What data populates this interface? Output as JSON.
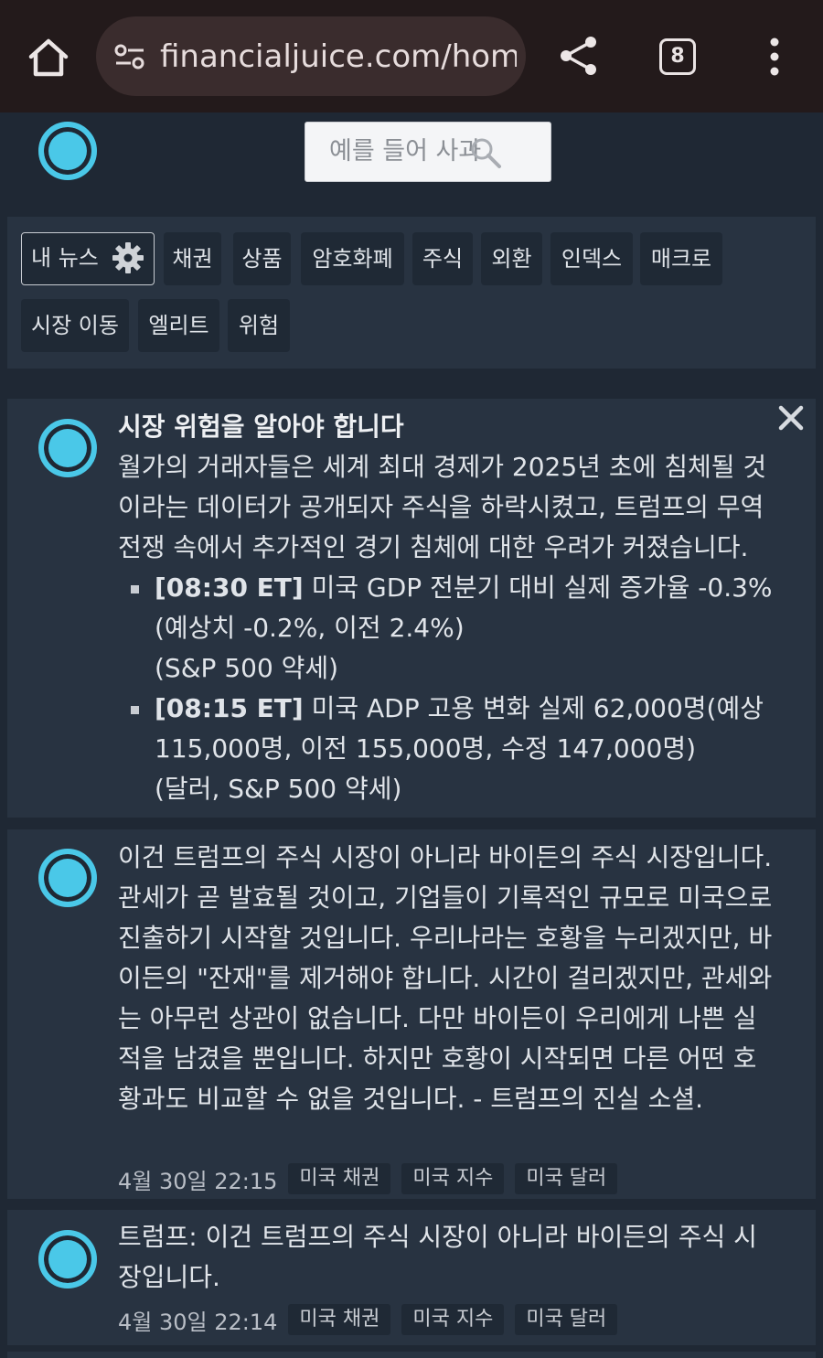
{
  "browser": {
    "url": "financialjuice.com/home",
    "tab_count": "8"
  },
  "search": {
    "placeholder": "예를 들어 사과"
  },
  "categories": {
    "mine_label": "내 뉴스",
    "items": [
      "채권",
      "상품",
      "암호화폐",
      "주식",
      "외환",
      "인덱스",
      "매크로",
      "시장 이동",
      "엘리트",
      "위험"
    ]
  },
  "cards": [
    {
      "headline": "시장 위험을 알아야 합니다",
      "body": "월가의 거래자들은 세계 최대 경제가 2025년 초에 침체될 것이라는 데이터가 공개되자 주식을 하락시켰고, 트럼프의 무역 전쟁 속에서 추가적인 경기 침체에 대한 우려가 커졌습니다.",
      "bullets": [
        {
          "time": "[08:30 ET]",
          "text": " 미국 GDP 전분기 대비 실제 증가율 -0.3% (예상치 -0.2%, 이전 2.4%)",
          "note": "(S&P 500 약세)"
        },
        {
          "time": "[08:15 ET]",
          "text": "  미국 ADP 고용 변화 실제 62,000명(예상 115,000명, 이전 155,000명, 수정 147,000명)",
          "note": "(달러, S&P 500 약세)"
        }
      ]
    },
    {
      "body": "이건 트럼프의 주식 시장이 아니라 바이든의 주식 시장입니다. 관세가 곧 발효될 것이고, 기업들이 기록적인 규모로 미국으로 진출하기 시작할 것입니다. 우리나라는 호황을 누리겠지만, 바이든의 \"잔재\"를 제거해야 합니다. 시간이 걸리겠지만, 관세와는 아무런 상관이 없습니다. 다만 바이든이 우리에게 나쁜 실적을 남겼을 뿐입니다. 하지만 호황이 시작되면 다른 어떤 호황과도 비교할 수 없을 것입니다. - 트럼프의 진실 소셜.",
      "timestamp": "4월 30일 22:15",
      "tags": [
        "미국 채권",
        "미국 지수",
        "미국 달러"
      ]
    },
    {
      "body": "트럼프: 이건 트럼프의 주식 시장이 아니라 바이든의 주식 시장입니다.",
      "timestamp": "4월 30일 22:14",
      "tags": [
        "미국 채권",
        "미국 지수",
        "미국 달러"
      ]
    }
  ],
  "colors": {
    "accent": "#4ac8e8",
    "background": "#1f2834",
    "panel": "#283341",
    "chrome": "#231a1b"
  }
}
